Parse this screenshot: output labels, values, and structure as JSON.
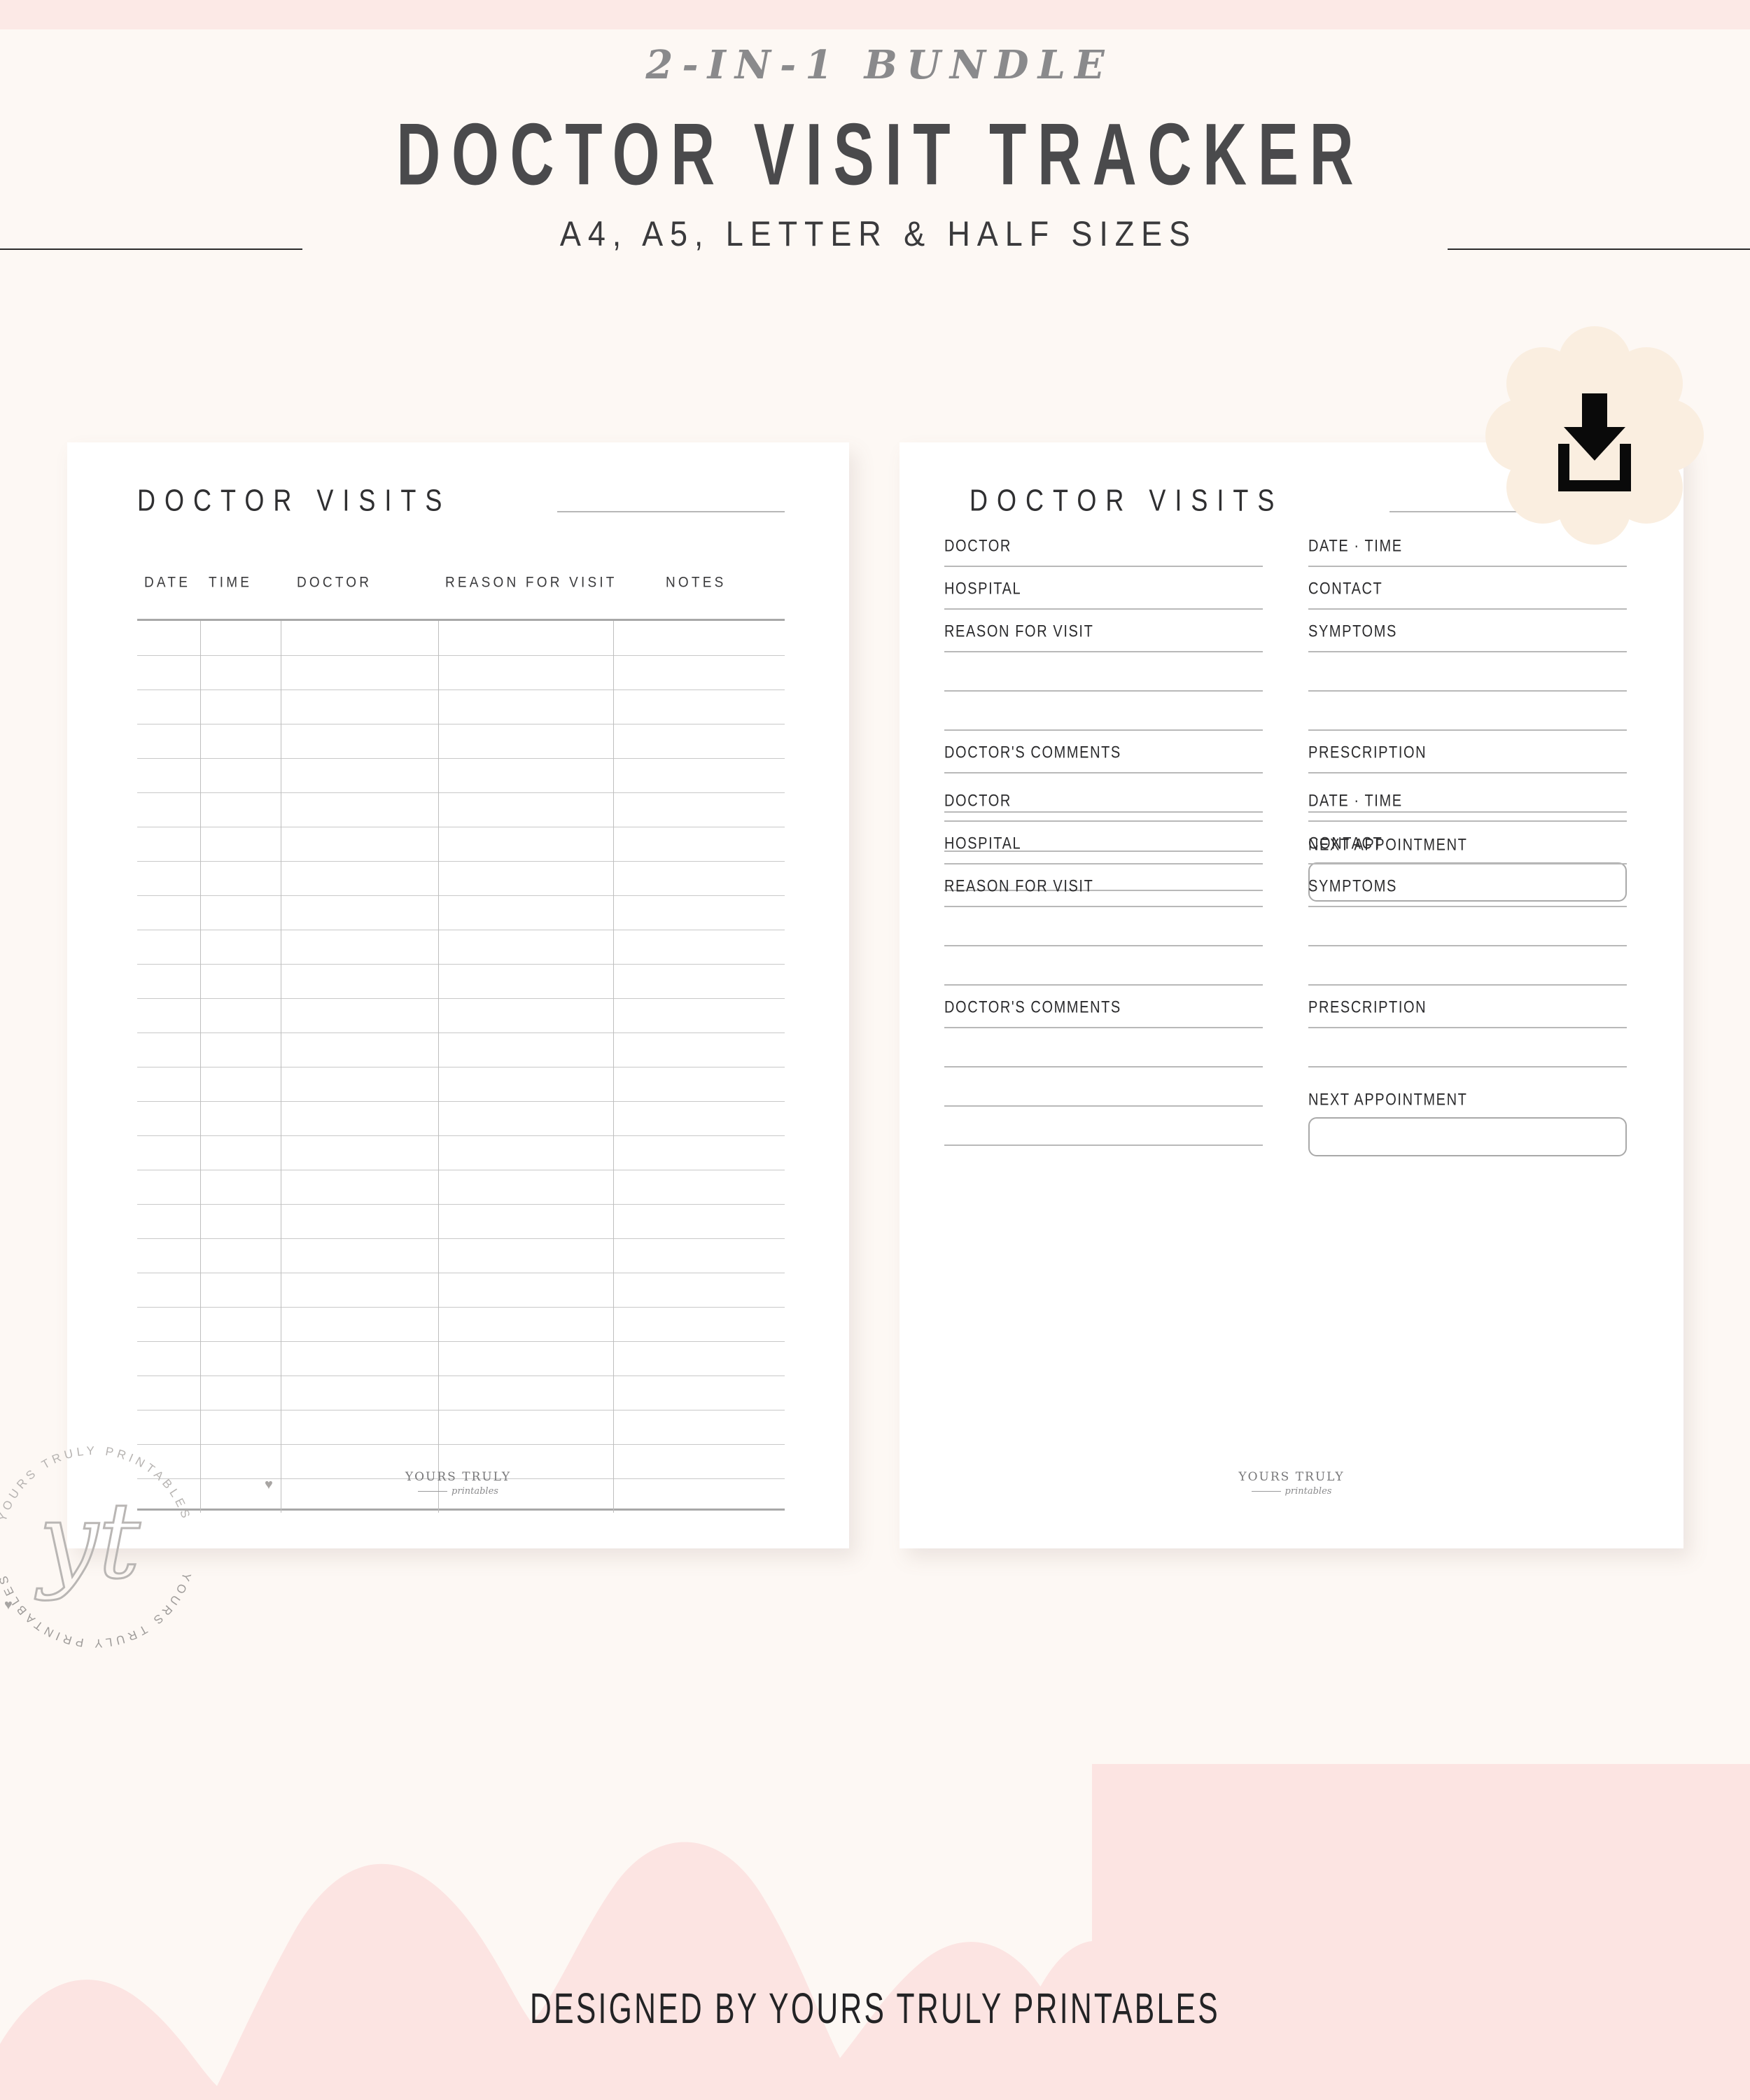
{
  "header": {
    "kicker": "2-IN-1 BUNDLE",
    "title": "DOCTOR VISIT TRACKER",
    "subtitle": "A4, A5, LETTER & HALF SIZES"
  },
  "badge": {
    "icon": "download-icon",
    "color": "#FAEEE0"
  },
  "colors": {
    "page_bg": "#FDF8F4",
    "top_band": "#FCE9E6",
    "wave_pink": "#FCE4E2",
    "sheet_white": "#FFFFFF",
    "rule_dark": "#2B2B2B",
    "grid_line": "#C8C8C8",
    "field_line": "#B9B9B9",
    "text_dark": "#2F2F31",
    "text_muted": "#8A8A8C"
  },
  "left_page": {
    "title": "DOCTOR VISITS",
    "columns": [
      "DATE",
      "TIME",
      "DOCTOR",
      "REASON FOR VISIT",
      "NOTES"
    ],
    "row_count": 26,
    "footer": {
      "brand": "YOURS TRULY",
      "tagline": "printables"
    }
  },
  "right_page": {
    "title": "DOCTOR VISITS",
    "blocks": [
      {
        "left_fields": [
          "DOCTOR",
          "HOSPITAL",
          "REASON FOR VISIT",
          "DOCTOR'S COMMENTS"
        ],
        "right_fields": [
          "DATE · TIME",
          "CONTACT",
          "SYMPTOMS",
          "PRESCRIPTION"
        ],
        "next_appointment_label": "NEXT APPOINTMENT"
      },
      {
        "left_fields": [
          "DOCTOR",
          "HOSPITAL",
          "REASON FOR VISIT",
          "DOCTOR'S COMMENTS"
        ],
        "right_fields": [
          "DATE · TIME",
          "CONTACT",
          "SYMPTOMS",
          "PRESCRIPTION"
        ],
        "next_appointment_label": "NEXT APPOINTMENT"
      }
    ],
    "footer": {
      "brand": "YOURS TRULY",
      "tagline": "printables"
    }
  },
  "watermark": {
    "monogram": "yt",
    "ring_text": "YOURS TRULY PRINTABLES"
  },
  "footer": {
    "text": "DESIGNED BY YOURS TRULY PRINTABLES"
  }
}
